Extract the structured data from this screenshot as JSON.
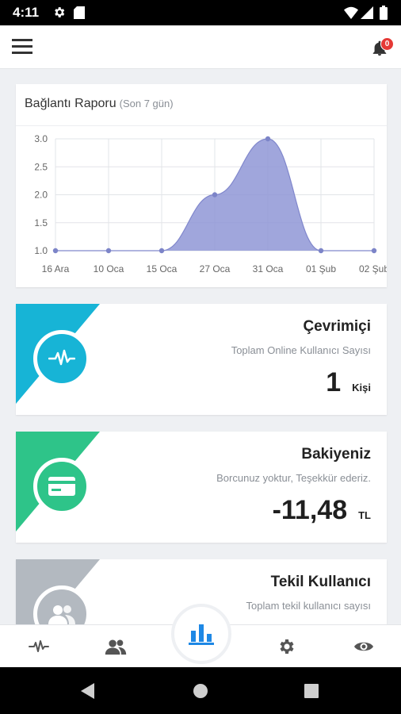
{
  "status_bar": {
    "time": "4:11"
  },
  "header": {
    "notification_count": "0"
  },
  "connection_report": {
    "title": "Bağlantı Raporu",
    "subtitle": "(Son 7 gün)"
  },
  "chart_data": {
    "type": "area",
    "title": "Bağlantı Raporu",
    "subtitle": "(Son 7 gün)",
    "categories": [
      "16 Ara",
      "10 Oca",
      "15 Oca",
      "27 Oca",
      "31 Oca",
      "01 Şub",
      "02 Şub"
    ],
    "values": [
      1.0,
      1.0,
      1.0,
      2.0,
      3.0,
      1.0,
      1.0
    ],
    "yticks": [
      "1.0",
      "1.5",
      "2.0",
      "2.5",
      "3.0"
    ],
    "ylim": [
      1.0,
      3.0
    ],
    "grid": true,
    "color": "#8f97d6"
  },
  "cards": [
    {
      "title": "Çevrimiçi",
      "description": "Toplam Online Kullanıcı Sayısı",
      "value": "1",
      "unit": "Kişi",
      "color": "#17b4d6",
      "icon": "pulse-icon"
    },
    {
      "title": "Bakiyeniz",
      "description": "Borcunuz yoktur, Teşekkür ederiz.",
      "value": "-11,48",
      "unit": "TL",
      "color": "#2ec489",
      "icon": "credit-card-icon"
    },
    {
      "title": "Tekil Kullanıcı",
      "description": "Toplam tekil kullanıcı sayısı",
      "value": "",
      "unit": "",
      "color": "#b3b9c0",
      "icon": "users-icon"
    }
  ],
  "bottom_nav": [
    "pulse-icon",
    "users-icon",
    "bar-chart-icon",
    "gear-icon",
    "eye-icon"
  ]
}
